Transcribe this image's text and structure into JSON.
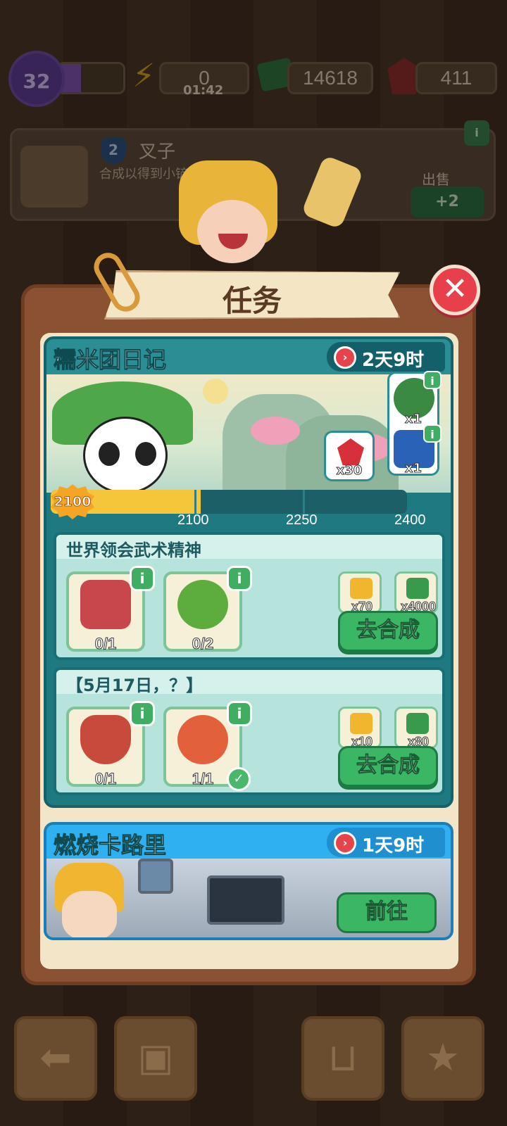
{
  "top_bar": {
    "level": "32",
    "energy": "0",
    "energy_timer": "01:42",
    "cash": "14618",
    "gems": "411"
  },
  "item_card": {
    "level": "2",
    "name": "叉子",
    "description": "合成以得到小铲子",
    "sell_label": "出售",
    "sell_value": "+2",
    "info_label": "i"
  },
  "dialog": {
    "title": "任务",
    "close_label": "✕"
  },
  "event_1": {
    "title": "糯米团日记",
    "timer": "2天9时",
    "current_points": "2100",
    "progress_fraction": 0.42,
    "milestones": [
      "2100",
      "2250",
      "2400"
    ],
    "rewards": [
      {
        "name": "gem",
        "qty": "x30"
      },
      {
        "name": "panda-avatar",
        "qty": "x1"
      },
      {
        "name": "treasure-chest",
        "qty": "x1"
      }
    ],
    "tasks": [
      {
        "title": "世界领会武术精神",
        "requirements": [
          {
            "icon": "saw-icon",
            "count": "0/1",
            "done": false
          },
          {
            "icon": "potted-plant-icon",
            "count": "0/2",
            "done": false
          }
        ],
        "rewards": [
          {
            "icon": "event-token-icon",
            "qty": "x70"
          },
          {
            "icon": "cash-icon",
            "qty": "x4000"
          }
        ],
        "button": "去合成"
      },
      {
        "title": "【5月17日，？】",
        "requirements": [
          {
            "icon": "plunger-icon",
            "count": "0/1",
            "done": false
          },
          {
            "icon": "flower-bush-icon",
            "count": "1/1",
            "done": true
          }
        ],
        "rewards": [
          {
            "icon": "event-token-icon",
            "qty": "x10"
          },
          {
            "icon": "cash-icon",
            "qty": "x80"
          }
        ],
        "button": "去合成"
      }
    ]
  },
  "event_2": {
    "title": "燃烧卡路里",
    "timer": "1天9时",
    "button": "前往"
  },
  "colors": {
    "panel": "#8a5232",
    "event1_header": "#2a8e94",
    "event2_header": "#2fb0f0",
    "button_green": "#3ab664",
    "close_red": "#e8404a",
    "progress_yellow": "#f6c63a"
  }
}
